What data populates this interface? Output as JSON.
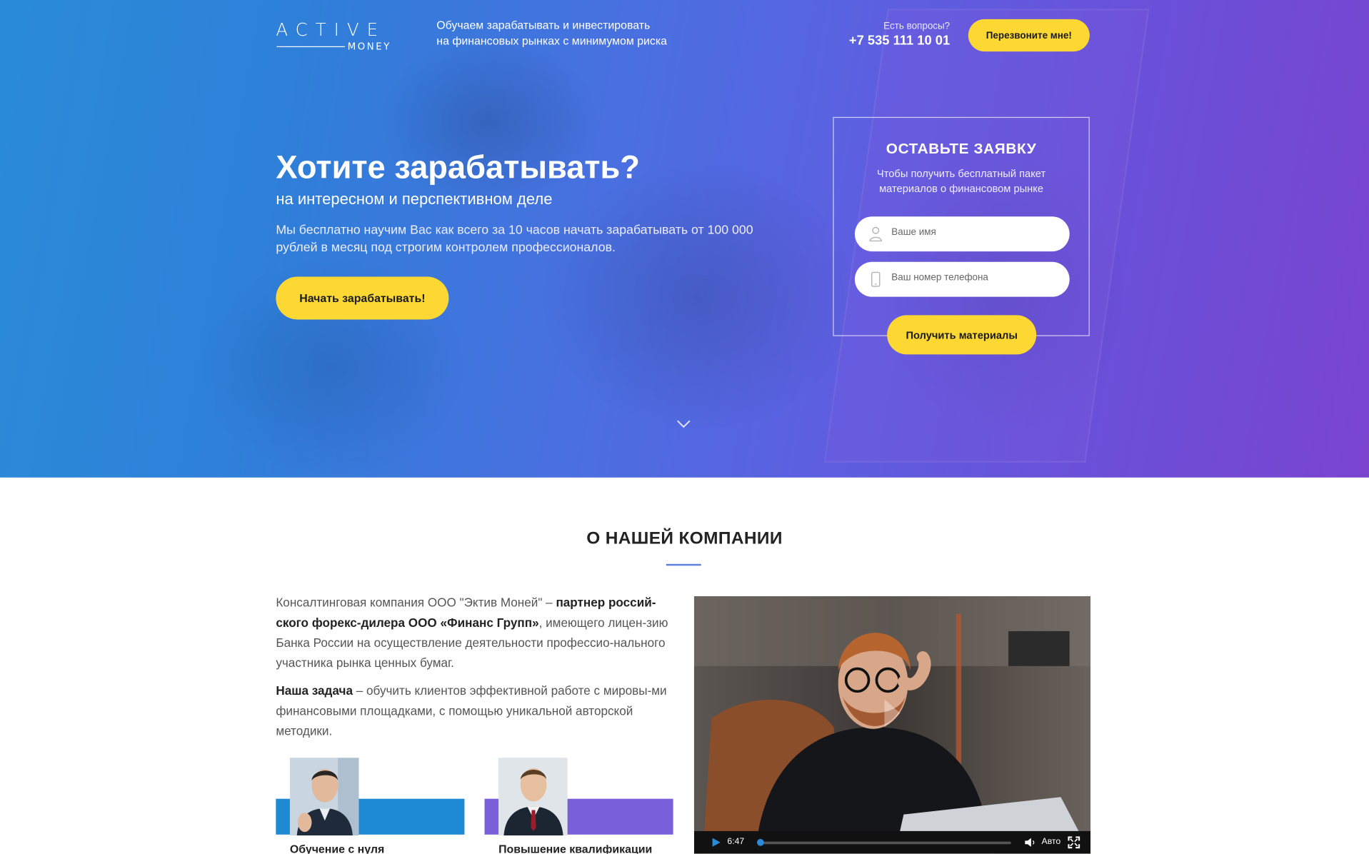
{
  "header": {
    "logo_top": "ACTIVE",
    "logo_bottom": "MONEY",
    "tagline_line1": "Обучаем зарабатывать и инвестировать",
    "tagline_line2": "на финансовых рынках с минимумом риска",
    "questions_label": "Есть вопросы?",
    "phone": "+7 535 111 10 01",
    "callback_button": "Перезвоните мне!"
  },
  "hero": {
    "title": "Хотите зарабатывать?",
    "subtitle": "на интересном и перспективном деле",
    "lead": "Мы бесплатно научим Вас как всего за 10 часов начать зарабатывать от 100 000 рублей в месяц под строгим контролем профессионалов.",
    "cta_button": "Начать зарабатывать!"
  },
  "form": {
    "title": "ОСТАВЬТЕ ЗАЯВКУ",
    "subtitle": "Чтобы получить бесплатный пакет материалов о финансовом рынке",
    "name_placeholder": "Ваше имя",
    "phone_placeholder": "Ваш номер телефона",
    "submit_button": "Получить материалы"
  },
  "about": {
    "title": "О НАШЕЙ КОМПАНИИ",
    "p1_text1": "Консалтинговая компания ООО \"Эктив Моней\" – ",
    "p1_bold": "партнер россий-ского форекс-дилера ООО «Финанс Групп»",
    "p1_text2": ", имеющего лицен-зию Банка России на осуществление деятельности профессио-нального участника рынка ценных бумаг.",
    "p2_bold": "Наша задача",
    "p2_text": " – обучить клиентов эффективной работе с мировы-ми финансовыми площадками, с помощью уникальной авторской методики.",
    "cards": [
      {
        "label": "Обучение с нуля"
      },
      {
        "label": "Повышение квалификации"
      }
    ]
  },
  "video": {
    "time": "6:47",
    "quality": "Авто",
    "progress": 0.0
  },
  "colors": {
    "accent_yellow": "#fdd833",
    "hero_blue": "#2a8cd8",
    "hero_purple": "#7a44cf",
    "card_blue": "#1d8ad3",
    "card_purple": "#7a5fdb"
  }
}
